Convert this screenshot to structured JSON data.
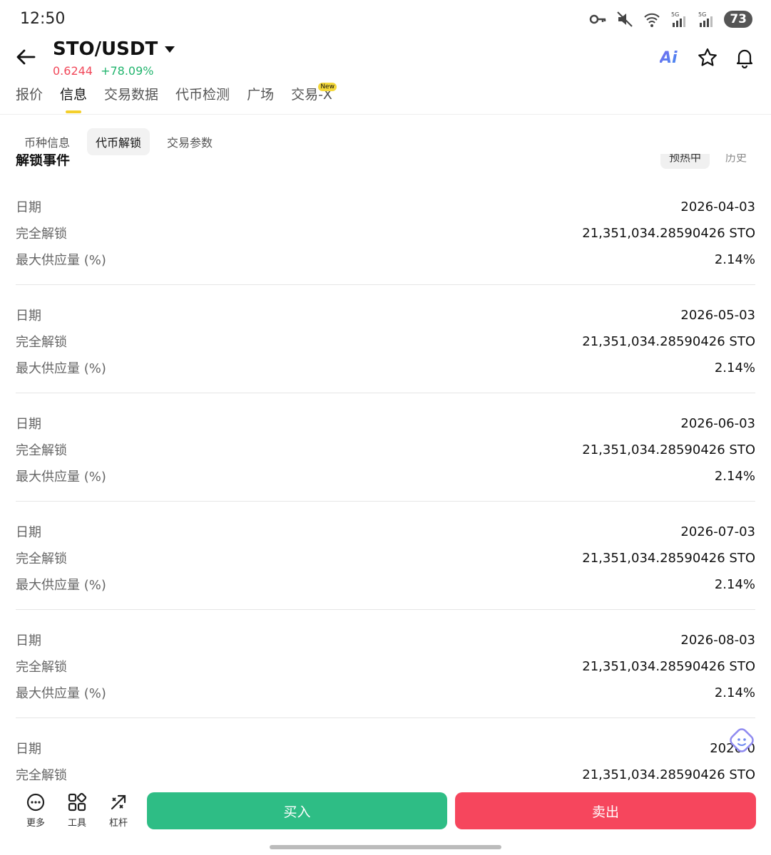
{
  "status_bar": {
    "time": "12:50",
    "battery": "73",
    "icons": [
      "key-icon",
      "mute-icon",
      "wifi-icon",
      "signal-5g-icon",
      "signal-5g-icon"
    ]
  },
  "header": {
    "pair": "STO/USDT",
    "price": "0.6244",
    "change": "+78.09%",
    "ai_label": "Ai",
    "actions": [
      "ai-icon",
      "star-icon",
      "bell-icon"
    ]
  },
  "main_tabs": [
    {
      "label": "报价"
    },
    {
      "label": "信息"
    },
    {
      "label": "交易数据"
    },
    {
      "label": "代币检测"
    },
    {
      "label": "广场"
    },
    {
      "label": "交易-X",
      "badge": "New"
    }
  ],
  "sub_tabs": [
    {
      "label": "币种信息"
    },
    {
      "label": "代币解锁"
    },
    {
      "label": "交易参数"
    }
  ],
  "section": {
    "title": "解锁事件",
    "filters": [
      "预热中",
      "历史"
    ]
  },
  "labels": {
    "date": "日期",
    "full_unlock": "完全解锁",
    "max_supply": "最大供应量 (%)"
  },
  "events": [
    {
      "date": "2026-04-03",
      "amount": "21,351,034.28590426 STO",
      "percent": "2.14%"
    },
    {
      "date": "2026-05-03",
      "amount": "21,351,034.28590426 STO",
      "percent": "2.14%"
    },
    {
      "date": "2026-06-03",
      "amount": "21,351,034.28590426 STO",
      "percent": "2.14%"
    },
    {
      "date": "2026-07-03",
      "amount": "21,351,034.28590426 STO",
      "percent": "2.14%"
    },
    {
      "date": "2026-08-03",
      "amount": "21,351,034.28590426 STO",
      "percent": "2.14%"
    },
    {
      "date": "2026-0",
      "amount": "21,351,034.28590426 STO",
      "percent": ""
    }
  ],
  "bottom": {
    "tools": [
      {
        "label": "更多",
        "icon": "more-icon"
      },
      {
        "label": "工具",
        "icon": "tools-icon"
      },
      {
        "label": "杠杆",
        "icon": "leverage-icon"
      }
    ],
    "buy": "买入",
    "sell": "卖出"
  },
  "colors": {
    "up": "#22b56e",
    "down": "#f1485a",
    "buy": "#2ebd85",
    "sell": "#f6465d",
    "tab_indicator": "#f4cf2b"
  }
}
